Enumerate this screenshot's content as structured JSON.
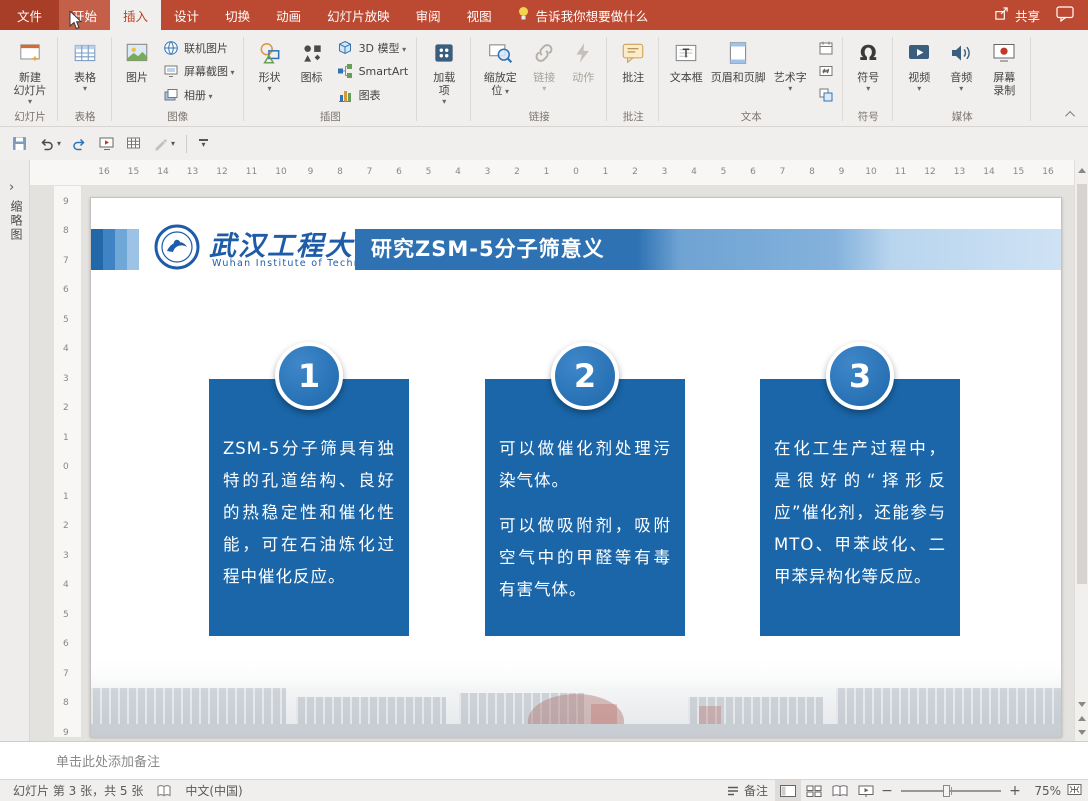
{
  "titlebar": {
    "tabs": [
      "文件",
      "开始",
      "插入",
      "设计",
      "切换",
      "动画",
      "幻灯片放映",
      "审阅",
      "视图"
    ],
    "tell_me": "告诉我你想要做什么",
    "share": "共享"
  },
  "ribbon": {
    "slides_group": {
      "label": "幻灯片",
      "new_slide": "新建\n幻灯片"
    },
    "tables_group": {
      "label": "表格",
      "table": "表格"
    },
    "images_group": {
      "label": "图像",
      "picture": "图片",
      "online_pictures": "联机图片",
      "screenshot": "屏幕截图",
      "photo_album": "相册"
    },
    "illustrations_group": {
      "label": "插图",
      "shapes": "形状",
      "icons": "图标",
      "models_3d": "3D 模型",
      "smartart": "SmartArt",
      "chart": "图表"
    },
    "addins_group": {
      "addins": "加载\n项"
    },
    "links_group": {
      "label": "链接",
      "zoom": "缩放定\n位",
      "link": "链接",
      "action": "动作"
    },
    "comments_group": {
      "label": "批注",
      "comment": "批注"
    },
    "text_group": {
      "label": "文本",
      "text_box": "文本框",
      "header_footer": "页眉和页脚",
      "wordart": "艺术字"
    },
    "symbols_group": {
      "label": "符号",
      "symbol": "符号"
    },
    "media_group": {
      "label": "媒体",
      "video": "视频",
      "audio": "音频",
      "screen_recording": "屏幕\n录制"
    }
  },
  "thumbnail_pane": {
    "label": "缩略图"
  },
  "rulers": {
    "horizontal": [
      16,
      15,
      14,
      13,
      12,
      11,
      10,
      9,
      8,
      7,
      6,
      5,
      4,
      3,
      2,
      1,
      0,
      1,
      2,
      3,
      4,
      5,
      6,
      7,
      8,
      9,
      10,
      11,
      12,
      13,
      14,
      15,
      16
    ],
    "vertical": [
      9,
      8,
      7,
      6,
      5,
      4,
      3,
      2,
      1,
      0,
      1,
      2,
      3,
      4,
      5,
      6,
      7,
      8,
      9
    ]
  },
  "slide": {
    "logo_cn": "武汉工程大学",
    "logo_en": "Wuhan Institute of Technology",
    "title": "研究ZSM-5分子筛意义",
    "boxes": [
      {
        "number": "1",
        "p1": "ZSM-5分子筛具有独特的孔道结构、良好的热稳定性和催化性能，可在石油炼化过程中催化反应。"
      },
      {
        "number": "2",
        "p1": "可以做催化剂处理污染气体。",
        "p2": "可以做吸附剂，吸附空气中的甲醛等有毒有害气体。"
      },
      {
        "number": "3",
        "p1": "在化工生产过程中，是很好的“择形反应”催化剂，还能参与MTO、甲苯歧化、二甲苯异构化等反应。"
      }
    ]
  },
  "notes": {
    "placeholder": "单击此处添加备注"
  },
  "statusbar": {
    "slide_indicator": "幻灯片 第 3 张，共 5 张",
    "language": "中文(中国)",
    "notes_label": "备注",
    "zoom_percent": "75%"
  },
  "colors": {
    "ribbon_red": "#BC4A32",
    "active_tab_text": "#B7472A",
    "slide_box_blue": "#1A66A9",
    "title_band_blue": "#2E72B4",
    "logo_blue": "#1E5CA8"
  },
  "icons": {
    "omega": "Ω",
    "expand_chevron": "›",
    "zoom_out": "−",
    "zoom_in": "+"
  }
}
